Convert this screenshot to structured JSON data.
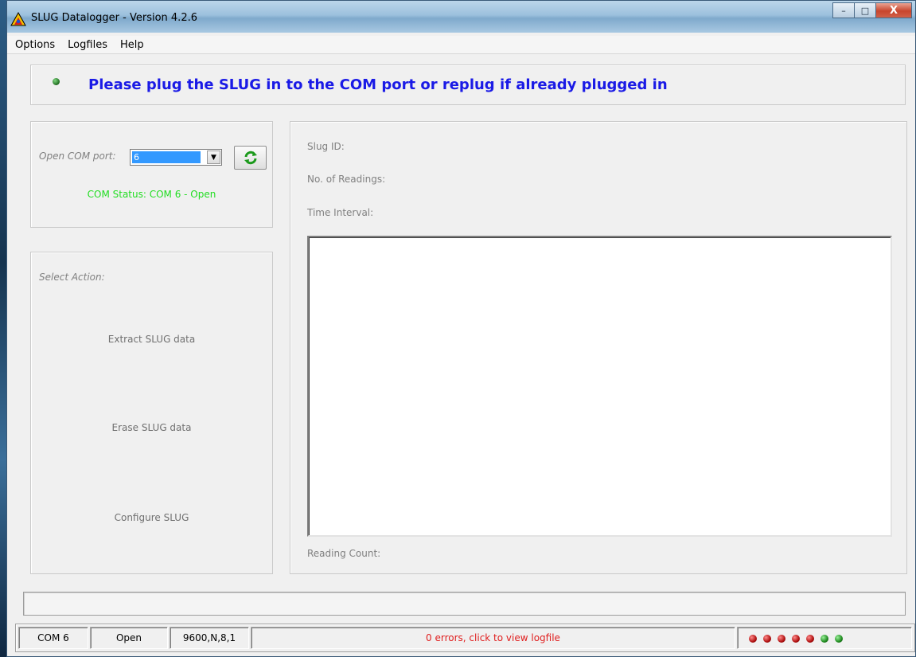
{
  "window": {
    "title": "SLUG Datalogger - Version 4.2.6",
    "minimize": "–",
    "maximize": "□",
    "close": "X"
  },
  "menu": [
    "Options",
    "Logfiles",
    "Help"
  ],
  "banner": {
    "message": "Please plug the SLUG in to the COM port or replug if already plugged in",
    "message_color": "#1a1ae6"
  },
  "port": {
    "label": "Open COM port:",
    "selected": "6",
    "status": "COM Status: COM 6 - Open",
    "status_color": "#22dd22"
  },
  "actions": {
    "title": "Select Action:",
    "extract": "Extract SLUG data",
    "erase": "Erase SLUG data",
    "configure": "Configure SLUG"
  },
  "info": {
    "slug_id": "Slug ID:",
    "readings": "No. of Readings:",
    "interval": "Time Interval:",
    "reading_count": "Reading Count:"
  },
  "status": {
    "port": "COM 6",
    "state": "Open",
    "settings": "9600,N,8,1",
    "errors": "0 errors, click to view logfile",
    "leds": [
      "red",
      "red",
      "red",
      "red",
      "red",
      "green",
      "green"
    ]
  }
}
